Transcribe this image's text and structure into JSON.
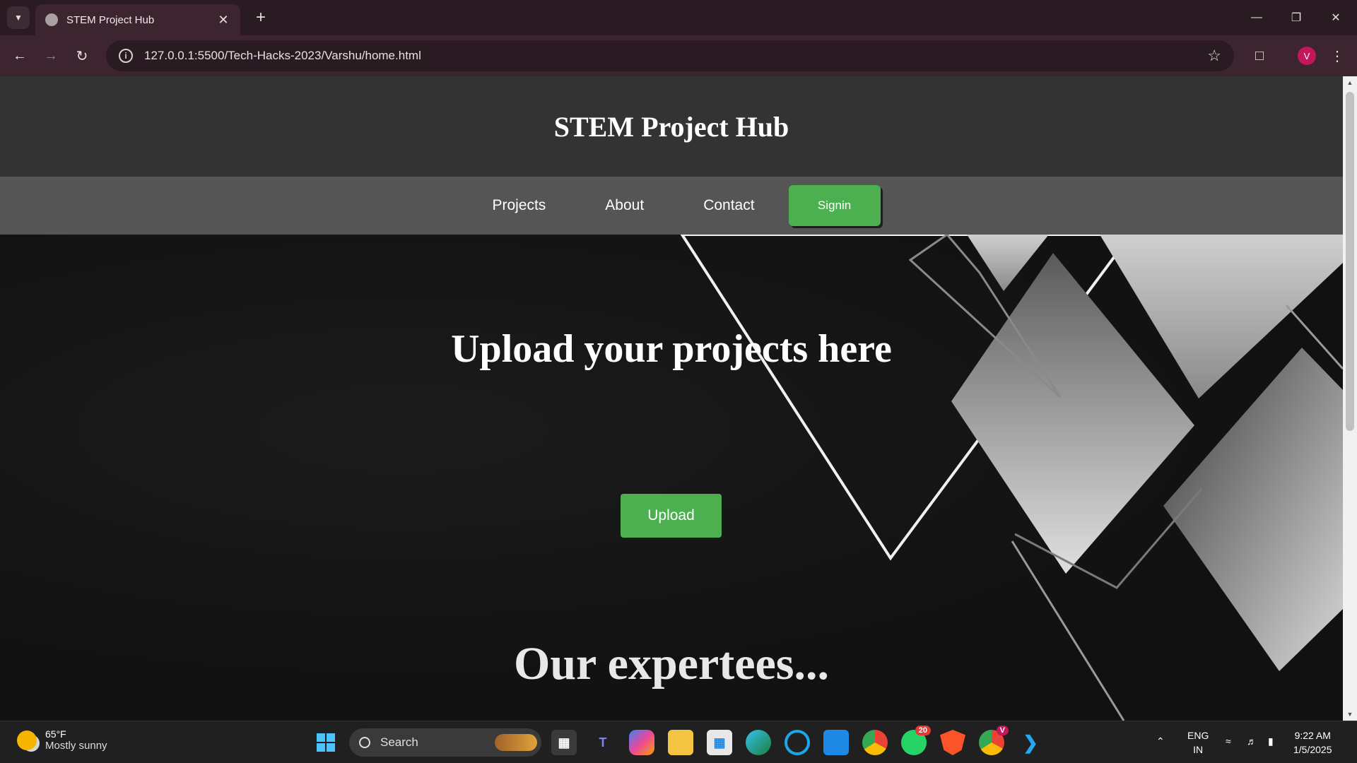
{
  "browser": {
    "tab_title": "STEM Project Hub",
    "url": "127.0.0.1:5500/Tech-Hacks-2023/Varshu/home.html",
    "profile_initial": "V"
  },
  "site": {
    "title": "STEM Project Hub",
    "nav": {
      "projects": "Projects",
      "about": "About",
      "contact": "Contact",
      "signin": "Signin"
    },
    "hero": {
      "heading": "Upload your projects here",
      "upload_button": "Upload",
      "section_heading": "Our expertees..."
    }
  },
  "taskbar": {
    "weather_temp": "65°F",
    "weather_desc": "Mostly sunny",
    "search_placeholder": "Search",
    "whatsapp_badge": "20",
    "chrome_badge": "V",
    "lang_line1": "ENG",
    "lang_line2": "IN",
    "time": "9:22 AM",
    "date": "1/5/2025"
  },
  "colors": {
    "accent_green": "#4caf50",
    "header_bg": "#333333",
    "nav_bg": "#555555",
    "chrome_bg": "#3d2530"
  }
}
